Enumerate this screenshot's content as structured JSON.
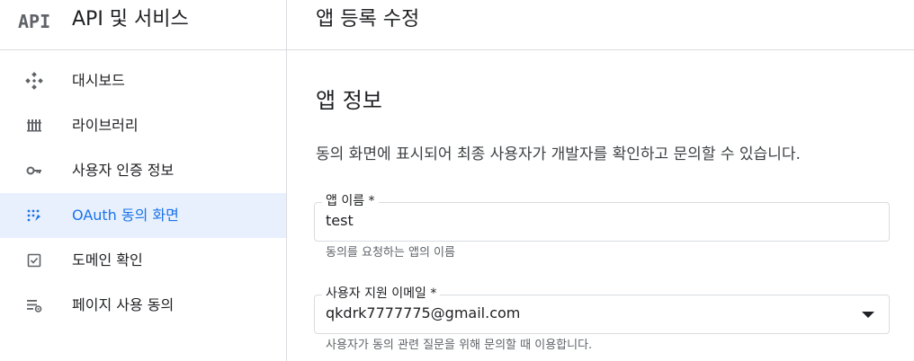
{
  "sidebar": {
    "logo_text": "API",
    "title": "API 및 서비스",
    "items": [
      {
        "label": "대시보드",
        "icon": "dashboard-icon",
        "active": false
      },
      {
        "label": "라이브러리",
        "icon": "library-icon",
        "active": false
      },
      {
        "label": "사용자 인증 정보",
        "icon": "key-icon",
        "active": false
      },
      {
        "label": "OAuth 동의 화면",
        "icon": "oauth-consent-icon",
        "active": true
      },
      {
        "label": "도메인 확인",
        "icon": "checkbox-icon",
        "active": false
      },
      {
        "label": "페이지 사용 동의",
        "icon": "settings-list-icon",
        "active": false
      }
    ]
  },
  "header": {
    "page_title": "앱 등록 수정"
  },
  "main": {
    "section_title": "앱 정보",
    "section_desc": "동의 화면에 표시되어 최종 사용자가 개발자를 확인하고 문의할 수 있습니다.",
    "app_name": {
      "label": "앱 이름 *",
      "value": "test",
      "hint": "동의를 요청하는 앱의 이름"
    },
    "support_email": {
      "label": "사용자 지원 이메일 *",
      "value": "qkdrk7777775@gmail.com",
      "hint": "사용자가 동의 관련 질문을 위해 문의할 때 이용합니다."
    }
  },
  "colors": {
    "accent": "#1a73e8",
    "active_bg": "#e8f0fe",
    "icon_gray": "#5f6368",
    "border": "#dadce0"
  }
}
